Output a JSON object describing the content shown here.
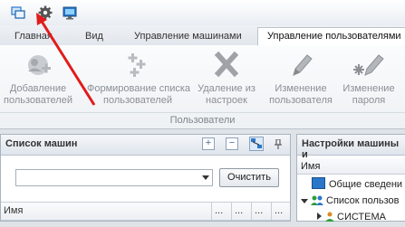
{
  "quick_access": {
    "icons": [
      "windows-icon",
      "gear-icon",
      "monitor-icon"
    ]
  },
  "tabs": [
    {
      "label": "Главная",
      "active": false
    },
    {
      "label": "Вид",
      "active": false
    },
    {
      "label": "Управление машинами",
      "active": false
    },
    {
      "label": "Управление пользователями",
      "active": true
    }
  ],
  "ribbon": {
    "buttons": [
      {
        "label_line1": "Добавление",
        "label_line2": "пользователей",
        "icon": "add-user-icon"
      },
      {
        "label_line1": "Формирование списка",
        "label_line2": "пользователей",
        "icon": "plus-list-icon"
      },
      {
        "label_line1": "Удаление из",
        "label_line2": "настроек",
        "icon": "delete-x-icon"
      },
      {
        "label_line1": "Изменение",
        "label_line2": "пользователя",
        "icon": "pencil-icon"
      },
      {
        "label_line1": "Изменение",
        "label_line2": "пароля",
        "icon": "pencil-key-icon"
      }
    ],
    "group_caption": "Пользователи"
  },
  "machines_panel": {
    "title": "Список машин",
    "clear_button": "Очистить",
    "combo_value": "",
    "columns": [
      "Имя",
      "...",
      "...",
      "...",
      "..."
    ]
  },
  "settings_panel": {
    "title": "Настройки машины и",
    "column": "Имя",
    "tree": [
      {
        "label": "Общие сведени",
        "icon": "monitor-icon"
      },
      {
        "label": "Список пользов",
        "icon": "users-icon"
      },
      {
        "label": "СИСТЕМА",
        "icon": "user-icon"
      }
    ]
  },
  "colors": {
    "accent": "#2a77c9",
    "arrow": "#e21b1b"
  }
}
